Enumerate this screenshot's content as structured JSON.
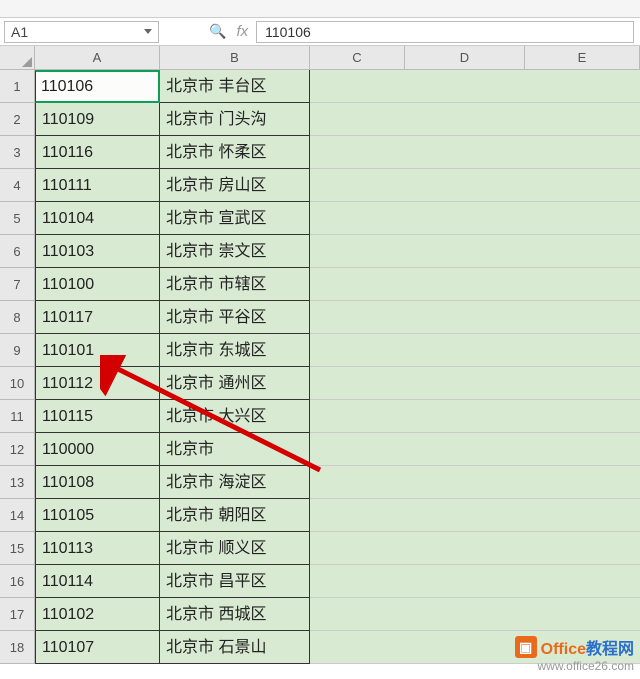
{
  "formula_bar": {
    "name_box": "A1",
    "fx_label": "fx",
    "value": "110106"
  },
  "columns": [
    "A",
    "B",
    "C",
    "D",
    "E"
  ],
  "rows": [
    {
      "n": "1",
      "a": "110106",
      "b": "北京市 丰台区"
    },
    {
      "n": "2",
      "a": "110109",
      "b": "北京市 门头沟"
    },
    {
      "n": "3",
      "a": "110116",
      "b": "北京市 怀柔区"
    },
    {
      "n": "4",
      "a": "110111",
      "b": "北京市 房山区"
    },
    {
      "n": "5",
      "a": "110104",
      "b": "北京市 宣武区"
    },
    {
      "n": "6",
      "a": "110103",
      "b": "北京市 崇文区"
    },
    {
      "n": "7",
      "a": "110100",
      "b": "北京市 市辖区"
    },
    {
      "n": "8",
      "a": "110117",
      "b": "北京市 平谷区"
    },
    {
      "n": "9",
      "a": "110101",
      "b": "北京市 东城区"
    },
    {
      "n": "10",
      "a": "110112",
      "b": "北京市 通州区"
    },
    {
      "n": "11",
      "a": "110115",
      "b": "北京市 大兴区"
    },
    {
      "n": "12",
      "a": "110000",
      "b": "北京市"
    },
    {
      "n": "13",
      "a": "110108",
      "b": "北京市 海淀区"
    },
    {
      "n": "14",
      "a": "110105",
      "b": "北京市 朝阳区"
    },
    {
      "n": "15",
      "a": "110113",
      "b": "北京市 顺义区"
    },
    {
      "n": "16",
      "a": "110114",
      "b": "北京市 昌平区"
    },
    {
      "n": "17",
      "a": "110102",
      "b": "北京市 西城区"
    },
    {
      "n": "18",
      "a": "110107",
      "b": "北京市 石景山"
    }
  ],
  "watermark": {
    "brand_office": "Office",
    "brand_cn": "教程网",
    "url": "www.office26.com"
  }
}
